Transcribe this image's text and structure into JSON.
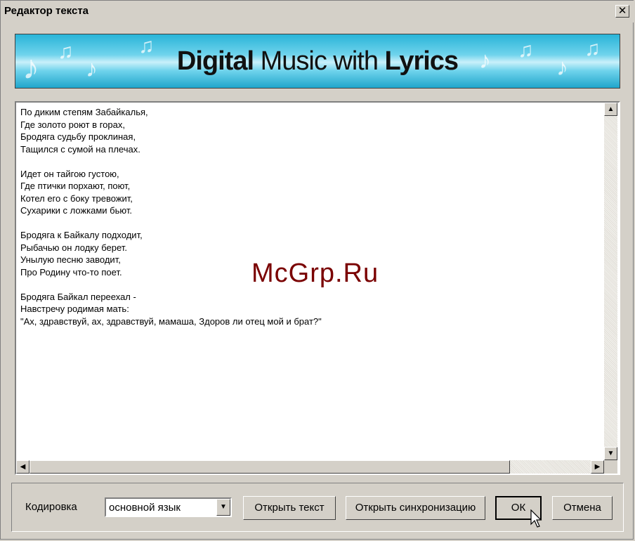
{
  "window": {
    "title": "Редактор текста",
    "close_glyph": "✕"
  },
  "banner": {
    "title_bold_1": "Digital",
    "title_regular": " Music with ",
    "title_bold_2": "Lyrics"
  },
  "content": {
    "lines": [
      "По диким степям Забайкалья,",
      "Где золото роют в горах,",
      "Бродяга судьбу проклиная,",
      "Тащился с сумой на плечах.",
      "",
      "Идет он тайгою густою,",
      "Где птички порхают, поют,",
      "Котел его с боку тревожит,",
      "Сухарики с ложками бьют.",
      "",
      "Бродяга к Байкалу подходит,",
      "Рыбачью он лодку берет.",
      "Унылую песню заводит,",
      "Про Родину что-то поет.",
      "",
      "Бродяга Байкал переехал -",
      "Навстречу родимая мать:",
      "\"Ах, здравствуй, ах, здравствуй, мамаша, Здоров ли отец мой и брат?\""
    ],
    "watermark": "McGrp.Ru"
  },
  "footer": {
    "encoding_label": "Кодировка",
    "encoding_value": "основной язык",
    "open_text_button": "Открыть текст",
    "open_sync_button": "Открыть синхронизацию",
    "ok_button": "ОК",
    "cancel_button": "Отмена"
  }
}
